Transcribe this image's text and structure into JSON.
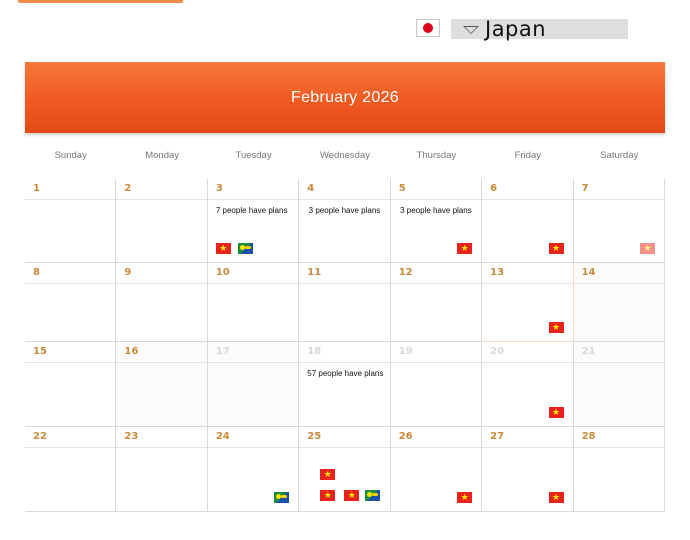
{
  "app": {
    "top_accent_color": "#f28b4a"
  },
  "country": {
    "flag_icon": "japan-flag-icon",
    "selected": "Japan",
    "dropdown_icon": "chevron-down-icon"
  },
  "calendar": {
    "title": "February 2026",
    "header_color": "#f05a22",
    "weekdays": [
      "Sunday",
      "Monday",
      "Tuesday",
      "Wednesday",
      "Thursday",
      "Friday",
      "Saturday"
    ],
    "weeks": [
      [
        {
          "day": "1",
          "plans": "",
          "flags": []
        },
        {
          "day": "2",
          "plans": "",
          "flags": []
        },
        {
          "day": "3",
          "plans": "7 people have plans",
          "flags": [
            "vietnam",
            "christmas-island"
          ]
        },
        {
          "day": "4",
          "plans": "3 people have plans",
          "flags": []
        },
        {
          "day": "5",
          "plans": "3 people have plans",
          "flags": [
            "vietnam"
          ]
        },
        {
          "day": "6",
          "plans": "",
          "flags": [
            "vietnam"
          ]
        },
        {
          "day": "7",
          "plans": "",
          "flags": [
            "vietnam-faded"
          ]
        }
      ],
      [
        {
          "day": "8",
          "plans": "",
          "flags": []
        },
        {
          "day": "9",
          "plans": "",
          "flags": []
        },
        {
          "day": "10",
          "plans": "",
          "flags": []
        },
        {
          "day": "11",
          "plans": "",
          "flags": []
        },
        {
          "day": "12",
          "plans": "",
          "flags": []
        },
        {
          "day": "13",
          "plans": "",
          "flags": [
            "vietnam"
          ]
        },
        {
          "day": "14",
          "plans": "",
          "flags": []
        }
      ],
      [
        {
          "day": "15",
          "plans": "",
          "flags": []
        },
        {
          "day": "16",
          "plans": "",
          "flags": []
        },
        {
          "day": "17",
          "plans": "",
          "flags": []
        },
        {
          "day": "18",
          "plans": "57 people have plans",
          "flags": []
        },
        {
          "day": "19",
          "plans": "",
          "flags": []
        },
        {
          "day": "20",
          "plans": "",
          "flags": [
            "vietnam"
          ]
        },
        {
          "day": "21",
          "plans": "",
          "flags": []
        }
      ],
      [
        {
          "day": "22",
          "plans": "",
          "flags": []
        },
        {
          "day": "23",
          "plans": "",
          "flags": []
        },
        {
          "day": "24",
          "plans": "",
          "flags": [
            "christmas-island"
          ]
        },
        {
          "day": "25",
          "plans": "",
          "flags": [
            "vietnam",
            "vietnam",
            "vietnam",
            "christmas-island"
          ]
        },
        {
          "day": "26",
          "plans": "",
          "flags": [
            "vietnam"
          ]
        },
        {
          "day": "27",
          "plans": "",
          "flags": [
            "vietnam"
          ]
        },
        {
          "day": "28",
          "plans": "",
          "flags": []
        }
      ]
    ]
  }
}
